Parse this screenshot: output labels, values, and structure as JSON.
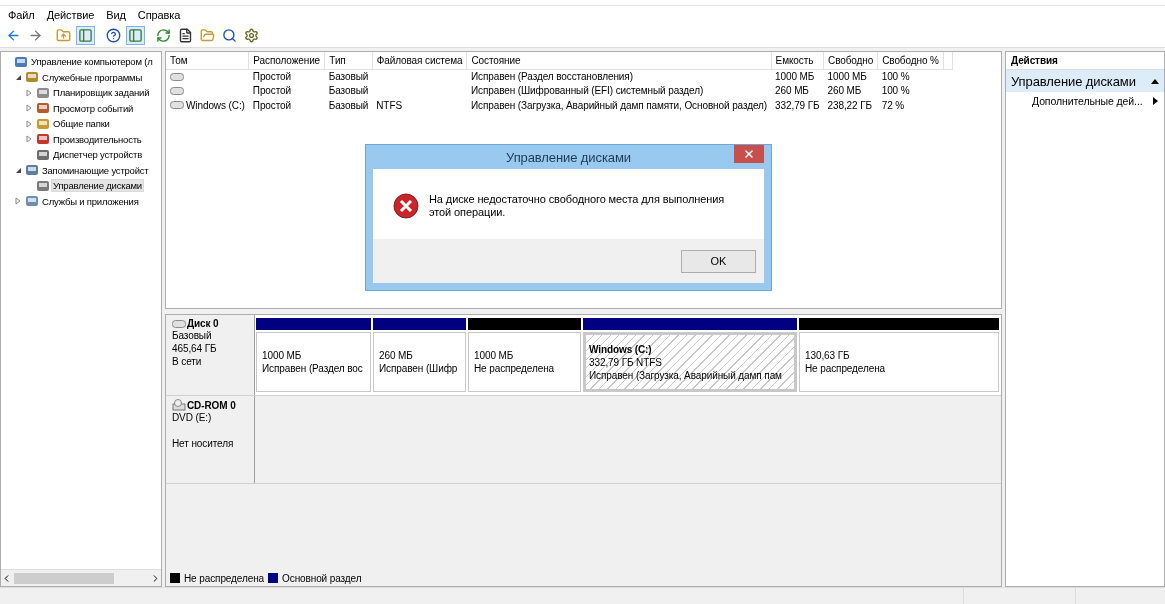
{
  "menu": [
    {
      "label": "Файл"
    },
    {
      "label": "Действие"
    },
    {
      "label": "Вид"
    },
    {
      "label": "Справка"
    }
  ],
  "toolbar": [
    {
      "kind": "back"
    },
    {
      "kind": "forward"
    },
    {
      "kind": "folder-up"
    },
    {
      "kind": "panel",
      "selected": true
    },
    {
      "kind": "help"
    },
    {
      "kind": "panel",
      "selected": true
    },
    {
      "kind": "refresh"
    },
    {
      "kind": "properties"
    },
    {
      "kind": "open-folder"
    },
    {
      "kind": "search"
    },
    {
      "kind": "settings"
    }
  ],
  "tree": [
    {
      "label": "Управление компьютером (л",
      "kind": "computer",
      "selected": false,
      "children": [
        {
          "label": "Служебные программы",
          "kind": "tools",
          "expanded": true,
          "selected": false,
          "children": [
            {
              "label": "Планировщик заданий",
              "kind": "clock",
              "expanded": false,
              "selected": false
            },
            {
              "label": "Просмотр событий",
              "kind": "log",
              "expanded": false,
              "selected": false
            },
            {
              "label": "Общие папки",
              "kind": "folder",
              "expanded": false,
              "selected": false
            },
            {
              "label": "Производительность",
              "kind": "gauge",
              "expanded": false,
              "selected": false
            },
            {
              "label": "Диспетчер устройств",
              "kind": "device",
              "selected": false
            }
          ]
        },
        {
          "label": "Запоминающие устройст",
          "kind": "storage",
          "expanded": true,
          "selected": false,
          "children": [
            {
              "label": "Управление дисками",
              "kind": "disk",
              "selected": true
            }
          ]
        },
        {
          "label": "Службы и приложения",
          "kind": "services",
          "expanded": false,
          "selected": false
        }
      ]
    }
  ],
  "table": {
    "columns": [
      "Том",
      "Расположение",
      "Тип",
      "Файловая система",
      "Состояние",
      "Емкость",
      "Свободно",
      "Свободно %"
    ],
    "rows": [
      {
        "layout": "Простой",
        "type": "Базовый",
        "status": "Исправен (Раздел восстановления)",
        "capacity": "1000 МБ",
        "free": "1000 МБ",
        "free_pct": "100 %"
      },
      {
        "layout": "Простой",
        "type": "Базовый",
        "status": "Исправен (Шифрованный (EFI) системный раздел)",
        "capacity": "260 МБ",
        "free": "260 МБ",
        "free_pct": "100 %"
      },
      {
        "volume": "Windows (C:)",
        "layout": "Простой",
        "type": "Базовый",
        "fs": "NTFS",
        "status": "Исправен (Загрузка, Аварийный дамп памяти, Основной раздел)",
        "capacity": "332,79 ГБ",
        "free": "238,22 ГБ",
        "free_pct": "72 %"
      }
    ]
  },
  "dialog": {
    "title": "Управление дисками",
    "message": "На диске недостаточно свободного места для выполнения этой операции.",
    "button": "OK"
  },
  "disks": [
    {
      "kind": "disk",
      "name": "Диск 0",
      "lines": [
        "Базовый",
        "465,64 ГБ",
        "В сети"
      ],
      "partitions": [
        {
          "kind": "primary",
          "selected": false,
          "size": "1000 МБ",
          "status": "Исправен (Раздел вос"
        },
        {
          "kind": "primary",
          "selected": false,
          "size": "260 МБ",
          "status": "Исправен (Шифр"
        },
        {
          "kind": "unallocated",
          "selected": false,
          "size": "1000 МБ",
          "status": "Не распределена"
        },
        {
          "kind": "primary",
          "selected": true,
          "name": "Windows  (C:)",
          "size": "332,79 ГБ NTFS",
          "status": "Исправен (Загрузка, Аварийный дамп пам"
        },
        {
          "kind": "unallocated",
          "selected": false,
          "size": "130,63 ГБ",
          "status": "Не распределена"
        }
      ]
    },
    {
      "kind": "cdrom",
      "name": "CD-ROM 0",
      "lines": [
        "DVD (E:)",
        "Нет носителя"
      ]
    }
  ],
  "legend": [
    {
      "label": "Не распределена",
      "color": "#000000"
    },
    {
      "label": "Основной раздел",
      "color": "#000080"
    }
  ],
  "actions": {
    "title": "Действия",
    "section": "Управление дисками",
    "expanded": true,
    "items": [
      "Дополнительные дей..."
    ]
  }
}
